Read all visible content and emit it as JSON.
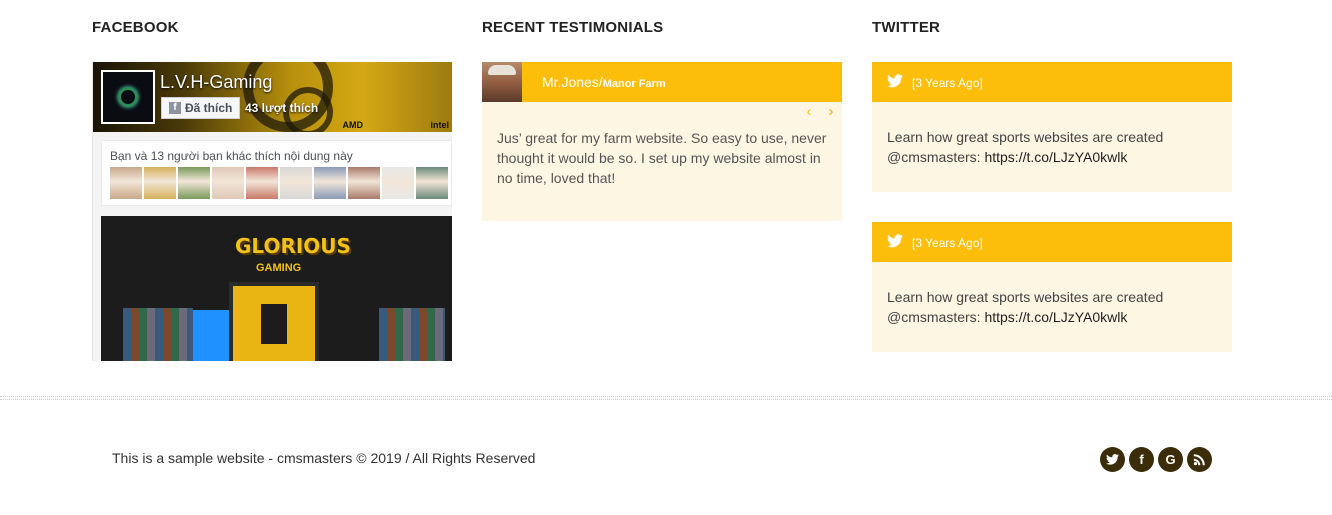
{
  "facebook": {
    "title": "FACEBOOK",
    "page_name": "L.V.H-Gaming",
    "like_button": "Đã thích",
    "like_count": "43 lượt thích",
    "friends_text": "Bạn và 13 người bạn khác thích nội dung này",
    "friend_faces": [
      "#c8a88a",
      "#d6b05a",
      "#7a9a5a",
      "#e0c8b8",
      "#c87a6a",
      "#d8d8d8",
      "#8a9ab8",
      "#a87a6a",
      "#e8e8e8",
      "#6a8a7a"
    ],
    "post_title": "GLORIOUS",
    "post_subtitle": "GAMING",
    "cover_brand_1": "AMD",
    "cover_brand_2": "intel"
  },
  "testimonials": {
    "title": "RECENT TESTIMONIALS",
    "author": "Mr.Jones/",
    "company": "Manor Farm",
    "text": "Jus’ great for my farm website. So easy to use, never thought it would be so. I set up my website almost in no time, loved that!",
    "prev_icon": "‹",
    "next_icon": "›"
  },
  "twitter": {
    "title": "TWITTER",
    "tweets": [
      {
        "time": "[3 Years Ago]",
        "text": "Learn how great sports websites are created @cmsmasters: ",
        "link": "https://t.co/LJzYA0kwlk"
      },
      {
        "time": "[3 Years Ago]",
        "text": "Learn how great sports websites are created @cmsmasters: ",
        "link": "https://t.co/LJzYA0kwlk"
      }
    ]
  },
  "footer": {
    "copyright": "This is a sample website - cmsmasters © 2019 / All Rights Reserved",
    "social": [
      {
        "name": "twitter",
        "glyph": "t"
      },
      {
        "name": "facebook",
        "glyph": "f"
      },
      {
        "name": "google",
        "glyph": "G"
      },
      {
        "name": "rss",
        "glyph": "rss"
      }
    ]
  },
  "colors": {
    "accent": "#fcbe0a",
    "panel_bg": "#fdf6e3",
    "social_bg": "#3b2c0a"
  }
}
